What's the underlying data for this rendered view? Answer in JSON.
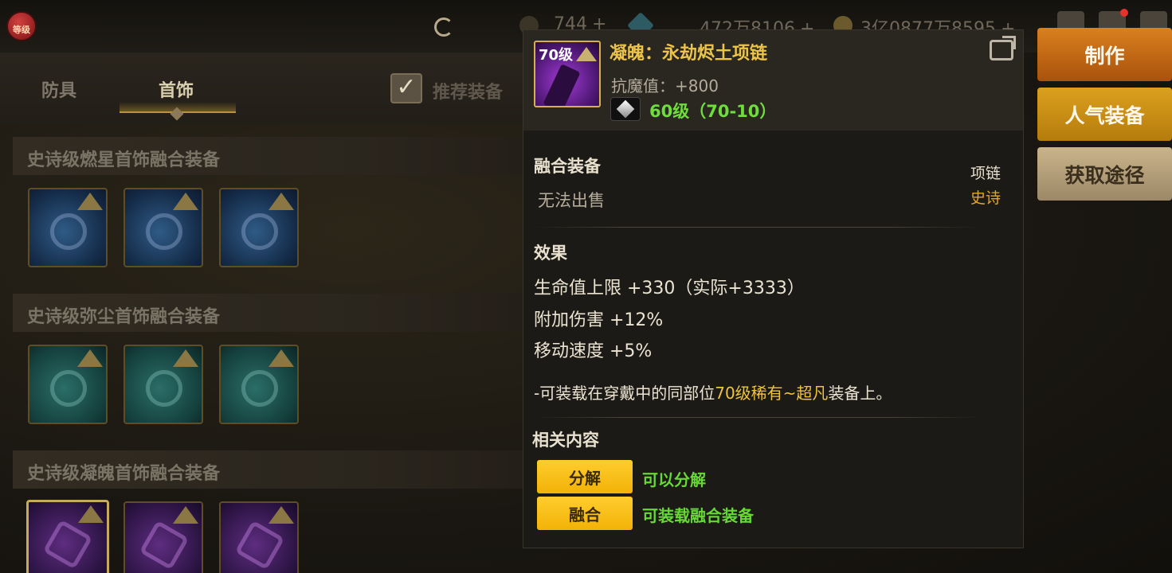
{
  "topbar": {
    "emblem_label": "等级",
    "currencies": [
      {
        "value": "744",
        "plus": "+"
      },
      {
        "value": "472万8106",
        "plus": "+"
      },
      {
        "value": "3亿0877万8595",
        "plus": "+"
      }
    ],
    "icons": [
      "chest-icon",
      "mail-icon",
      "menu-icon"
    ]
  },
  "left": {
    "tabs": [
      {
        "label": "防具",
        "active": false
      },
      {
        "label": "首饰",
        "active": true
      }
    ],
    "recommend_label": "推荐装备",
    "recommend_checked": true,
    "sections": [
      {
        "title": "史诗级燃星首饰融合装备",
        "slots": 3,
        "color": "blue"
      },
      {
        "title": "史诗级弥尘首饰融合装备",
        "slots": 3,
        "color": "teal"
      },
      {
        "title": "史诗级凝魄首饰融合装备",
        "slots": 3,
        "color": "purple"
      }
    ]
  },
  "popup": {
    "icon_level": "70级",
    "item_name": "凝魄：永劫烬土项链",
    "magic_resist": "抗魔值：+800",
    "gem_level": "60级（70-10）",
    "fusion_label": "融合装备",
    "no_sell": "无法出售",
    "item_type": "项链",
    "rarity": "史诗",
    "effect_title": "效果",
    "effects": [
      "生命值上限 +330（实际+3333）",
      "附加伤害 +12%",
      "移动速度 +5%"
    ],
    "note_prefix": "-可装载在穿戴中的同部位",
    "note_highlight": "70级稀有~超凡",
    "note_suffix": "装备上。",
    "related_title": "相关内容",
    "related": [
      {
        "button": "分解",
        "desc": "可以分解"
      },
      {
        "button": "融合",
        "desc": "可装载融合装备"
      }
    ]
  },
  "side_buttons": {
    "make": "制作",
    "popular": "人气装备",
    "obtain": "获取途径"
  },
  "colors": {
    "rarity_epic": "#e6a622",
    "item_name": "#ecc44a",
    "green_text": "#66d935",
    "yellow_button": "#f2b207"
  }
}
